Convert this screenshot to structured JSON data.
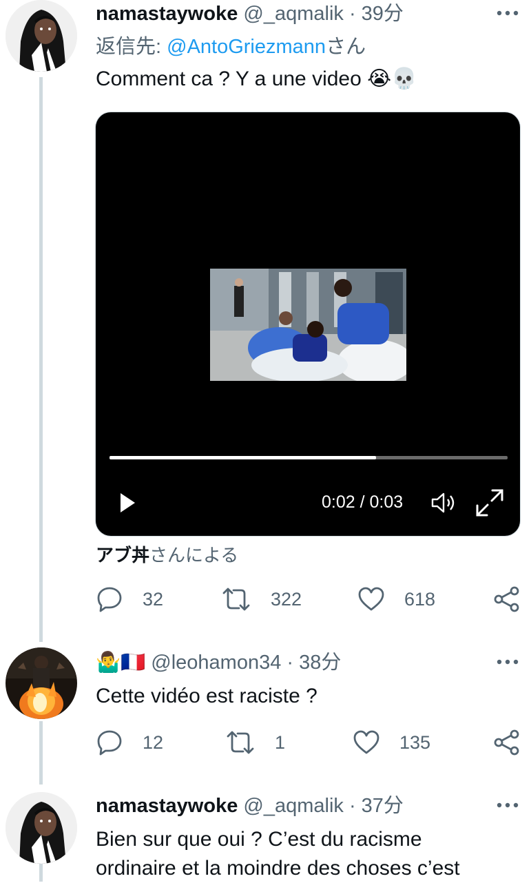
{
  "tweets": [
    {
      "name": "namastaywoke",
      "handle": "@_aqmalik",
      "time": "· 39分",
      "reply_label": "返信先: ",
      "reply_to": "@AntoGriezmann",
      "reply_suffix": "さん",
      "text": "Comment ca ? Y a une video 😭💀",
      "video": {
        "current_time": "0:02",
        "separator": " / ",
        "duration": "0:03",
        "progress_fraction": 0.67
      },
      "attribution_name": "アブ丼",
      "attribution_suffix": "さんによる",
      "replies": "32",
      "retweets": "322",
      "likes": "618"
    },
    {
      "name_emoji": "🤷‍♂️🇫🇷",
      "handle": "@leohamon34",
      "time": "· 38分",
      "text": "Cette vidéo est raciste ?",
      "replies": "12",
      "retweets": "1",
      "likes": "135"
    },
    {
      "name": "namastaywoke",
      "handle": "@_aqmalik",
      "time": "· 37分",
      "text_line1": "Bien sur que oui ? C’est du racisme",
      "text_line2": "ordinaire et la moindre des choses c’est"
    }
  ],
  "icons": {
    "more": "more-dots-icon",
    "reply": "reply-icon",
    "retweet": "retweet-icon",
    "like": "heart-icon",
    "share": "share-icon",
    "play": "play-icon",
    "volume": "volume-icon",
    "fullscreen": "fullscreen-icon"
  },
  "colors": {
    "link": "#1d9bf0",
    "muted": "#536471",
    "thread_line": "#cfd9de"
  }
}
